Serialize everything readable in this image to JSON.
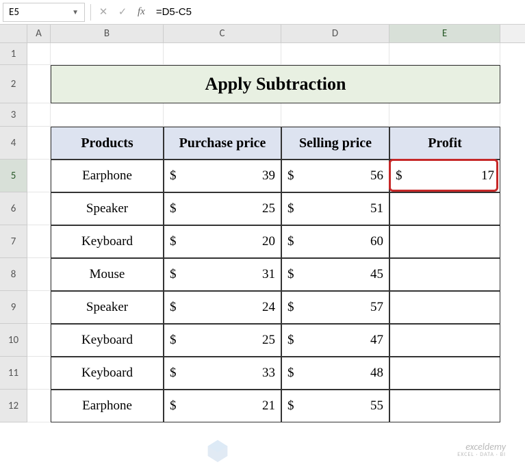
{
  "formula_bar": {
    "cell_ref": "E5",
    "formula": "=D5-C5",
    "fx_label": "fx"
  },
  "columns": [
    "A",
    "B",
    "C",
    "D",
    "E"
  ],
  "rows": [
    "1",
    "2",
    "3",
    "4",
    "5",
    "6",
    "7",
    "8",
    "9",
    "10",
    "11",
    "12"
  ],
  "title": "Apply Subtraction",
  "headers": {
    "products": "Products",
    "purchase": "Purchase price",
    "selling": "Selling price",
    "profit": "Profit"
  },
  "currency": "$",
  "table": [
    {
      "product": "Earphone",
      "purchase": 39,
      "selling": 56,
      "profit": 17
    },
    {
      "product": "Speaker",
      "purchase": 25,
      "selling": 51,
      "profit": ""
    },
    {
      "product": "Keyboard",
      "purchase": 20,
      "selling": 60,
      "profit": ""
    },
    {
      "product": "Mouse",
      "purchase": 31,
      "selling": 45,
      "profit": ""
    },
    {
      "product": "Speaker",
      "purchase": 24,
      "selling": 57,
      "profit": ""
    },
    {
      "product": "Keyboard",
      "purchase": 25,
      "selling": 47,
      "profit": ""
    },
    {
      "product": "Keyboard",
      "purchase": 33,
      "selling": 48,
      "profit": ""
    },
    {
      "product": "Earphone",
      "purchase": 21,
      "selling": 55,
      "profit": ""
    }
  ],
  "watermark": {
    "brand": "exceldemy",
    "tag": "EXCEL · DATA · BI"
  },
  "chart_data": {
    "type": "table",
    "title": "Apply Subtraction",
    "columns": [
      "Products",
      "Purchase price",
      "Selling price",
      "Profit"
    ],
    "rows": [
      [
        "Earphone",
        39,
        56,
        17
      ],
      [
        "Speaker",
        25,
        51,
        null
      ],
      [
        "Keyboard",
        20,
        60,
        null
      ],
      [
        "Mouse",
        31,
        45,
        null
      ],
      [
        "Speaker",
        24,
        57,
        null
      ],
      [
        "Keyboard",
        25,
        47,
        null
      ],
      [
        "Keyboard",
        33,
        48,
        null
      ],
      [
        "Earphone",
        21,
        55,
        null
      ]
    ]
  }
}
